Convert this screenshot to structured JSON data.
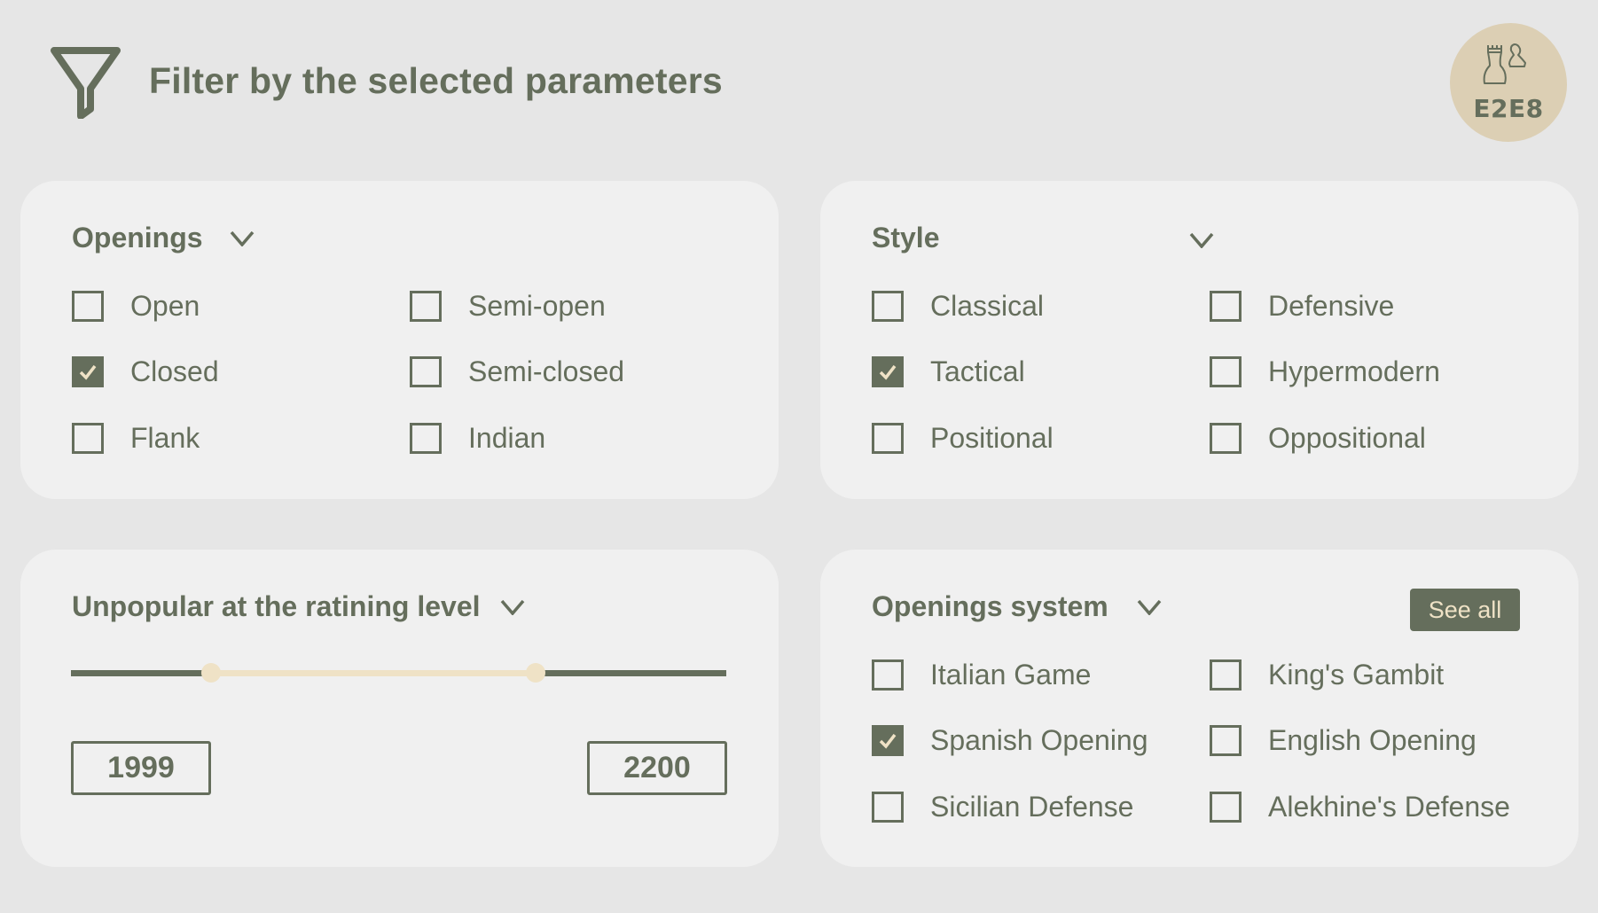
{
  "header": {
    "title": "Filter by the selected parameters",
    "icon": "filter-funnel-icon"
  },
  "logo": {
    "text": "E2E8",
    "icon": "chess-rook-pawn-icon",
    "background": "#dccfb4"
  },
  "colors": {
    "background": "#e6e6e6",
    "card": "#f0f0f0",
    "primary": "#656e5c",
    "accent": "#efe2c6"
  },
  "openings": {
    "title": "Openings",
    "options": [
      {
        "label": "Open",
        "checked": false
      },
      {
        "label": "Semi-open",
        "checked": false
      },
      {
        "label": "Closed",
        "checked": true
      },
      {
        "label": "Semi-closed",
        "checked": false
      },
      {
        "label": "Flank",
        "checked": false
      },
      {
        "label": "Indian",
        "checked": false
      }
    ]
  },
  "style": {
    "title": "Style",
    "options": [
      {
        "label": "Classical",
        "checked": false
      },
      {
        "label": "Defensive",
        "checked": false
      },
      {
        "label": "Tactical",
        "checked": true
      },
      {
        "label": "Hypermodern",
        "checked": false
      },
      {
        "label": "Positional",
        "checked": false
      },
      {
        "label": "Oppositional",
        "checked": false
      }
    ]
  },
  "rating": {
    "title": "Unpopular at the ratining level",
    "min_value": "1999",
    "max_value": "2200",
    "slider_low_fraction": 0.214,
    "slider_high_fraction": 0.709
  },
  "system": {
    "title": "Openings system",
    "see_all_label": "See all",
    "options": [
      {
        "label": "Italian Game",
        "checked": false
      },
      {
        "label": "King's Gambit",
        "checked": false
      },
      {
        "label": "Spanish Opening",
        "checked": true
      },
      {
        "label": "English Opening",
        "checked": false
      },
      {
        "label": "Sicilian Defense",
        "checked": false
      },
      {
        "label": "Alekhine's Defense",
        "checked": false
      }
    ]
  }
}
